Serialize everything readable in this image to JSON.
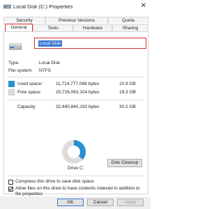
{
  "window": {
    "title": "Local Disk (C:) Properties",
    "close_glyph": "✕"
  },
  "tabs": {
    "row1": [
      {
        "label": "Security"
      },
      {
        "label": "Previous Versions"
      },
      {
        "label": "Quota"
      }
    ],
    "row2": [
      {
        "label": "General",
        "selected": true
      },
      {
        "label": "Tools"
      },
      {
        "label": "Hardware"
      },
      {
        "label": "Sharing"
      }
    ]
  },
  "general": {
    "name_value": "Local Disk",
    "type_label": "Type:",
    "type_value": "Local Disk",
    "fs_label": "File system:",
    "fs_value": "NTFS",
    "used_label": "Used space:",
    "used_bytes": "11,714,777,088 bytes",
    "used_size": "10.9 GB",
    "free_label": "Free space:",
    "free_bytes": "20,726,063,104 bytes",
    "free_size": "19.3 GB",
    "capacity_label": "Capacity:",
    "capacity_bytes": "32,440,840,192 bytes",
    "capacity_size": "30.2 GB",
    "used_fraction": 0.361,
    "drive_label": "Drive C:",
    "cleanup_label": "Disk Cleanup",
    "compress_label": "Compress this drive to save disk space",
    "compress_checked": false,
    "index_label": "Allow files on this drive to have contents indexed in addition to file properties",
    "index_checked": true
  },
  "footer": {
    "ok": "OK",
    "cancel": "Cancel",
    "apply": "Apply"
  },
  "colors": {
    "used": "#2b8fd4",
    "free": "#dcdcdc",
    "highlight": "#d22f2f",
    "selection": "#3a78d4"
  }
}
